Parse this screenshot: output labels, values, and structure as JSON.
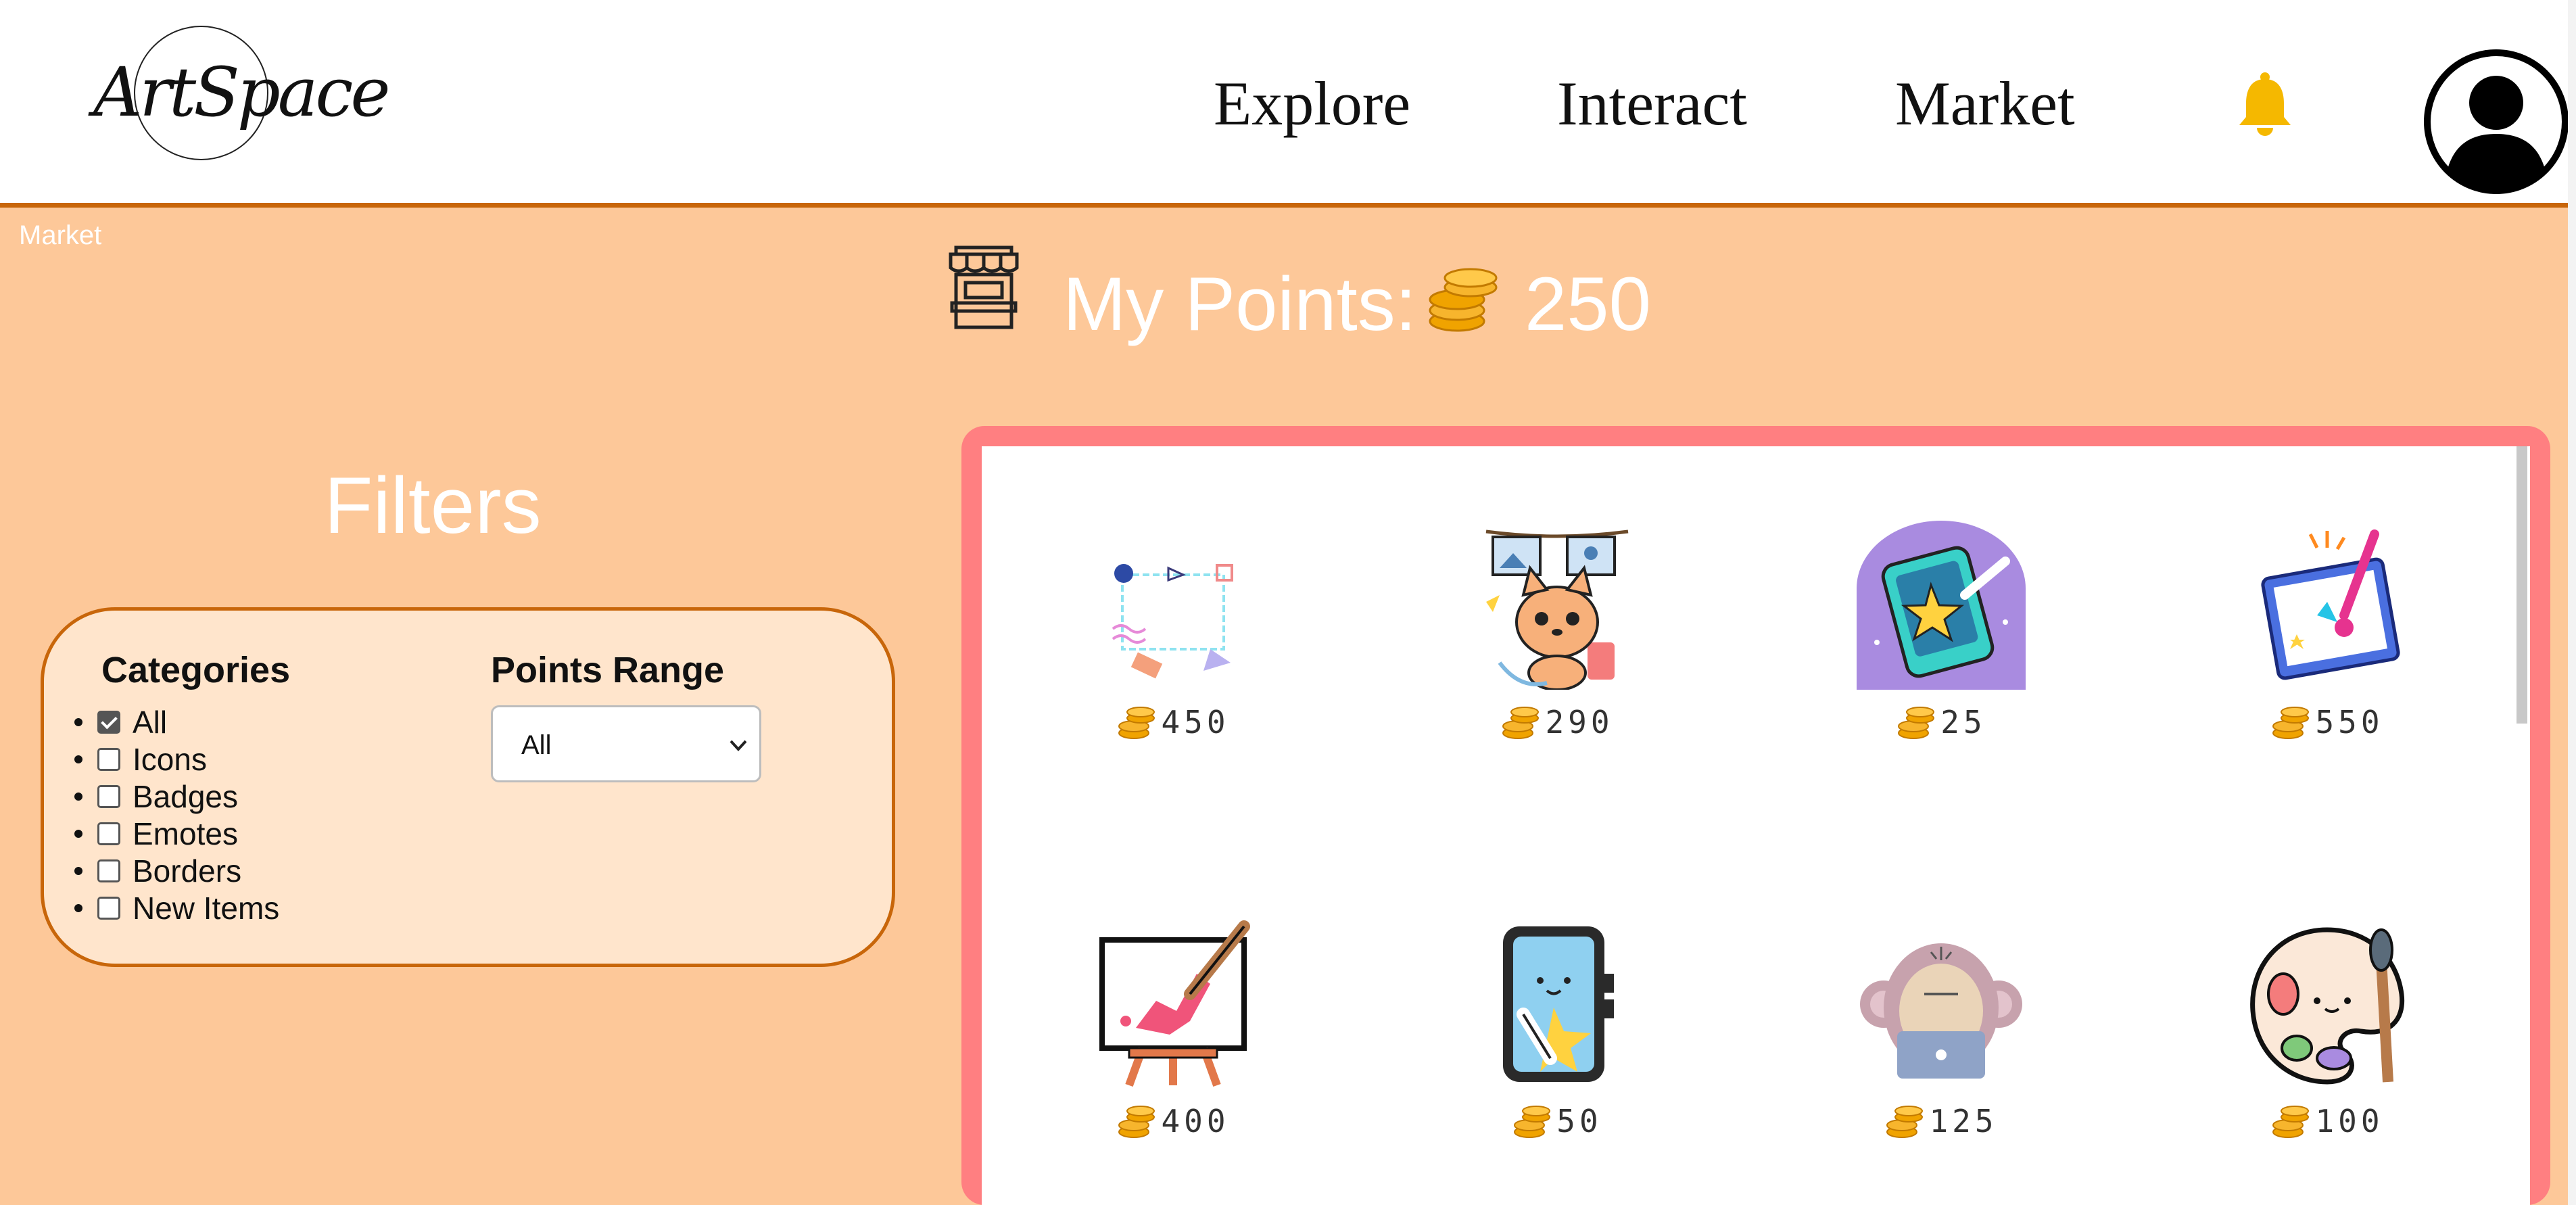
{
  "header": {
    "logo_text": "ArtSpace",
    "nav": [
      {
        "label": "Explore"
      },
      {
        "label": "Interact"
      },
      {
        "label": "Market"
      }
    ],
    "icons": {
      "notifications": "bell-icon",
      "profile": "user-avatar-icon"
    },
    "colors": {
      "bell": "#f5b800",
      "border": "#c8660a"
    }
  },
  "breadcrumb": "Market",
  "points": {
    "label": "My Points:",
    "value": "250",
    "icon": "shop-icon",
    "coin_icon": "coin-stack-icon"
  },
  "filters": {
    "title": "Filters",
    "categories_title": "Categories",
    "categories": [
      {
        "label": "All",
        "checked": true
      },
      {
        "label": "Icons",
        "checked": false
      },
      {
        "label": "Badges",
        "checked": false
      },
      {
        "label": "Emotes",
        "checked": false
      },
      {
        "label": "Borders",
        "checked": false
      },
      {
        "label": "New Items",
        "checked": false
      }
    ],
    "range_title": "Points Range",
    "range_selected": "All"
  },
  "market": {
    "accent": "#ff7f81",
    "items": [
      {
        "icon": "decorative-border-icon",
        "price": "450"
      },
      {
        "icon": "fox-artist-icon",
        "price": "290"
      },
      {
        "icon": "tablet-star-badge-icon",
        "price": "25"
      },
      {
        "icon": "time-to-create-icon",
        "price": "550"
      },
      {
        "icon": "easel-painting-icon",
        "price": "400"
      },
      {
        "icon": "drawing-tablet-icon",
        "price": "50"
      },
      {
        "icon": "monkey-laptop-icon",
        "price": "125"
      },
      {
        "icon": "paint-palette-icon",
        "price": "100"
      }
    ]
  }
}
